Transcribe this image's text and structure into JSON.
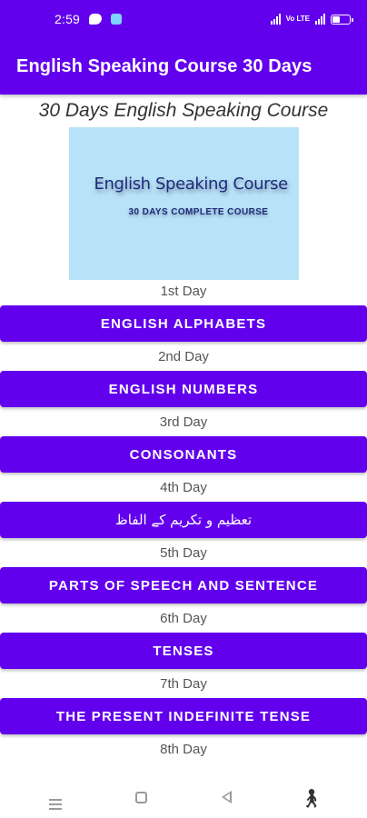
{
  "status": {
    "time": "2:59",
    "network_badge": "Vo LTE"
  },
  "appbar": {
    "title": "English Speaking Course 30 Days"
  },
  "header": {
    "subtitle": "30 Days English Speaking Course"
  },
  "banner": {
    "title": "English Speaking Course",
    "subtitle": "30 DAYS COMPLETE COURSE"
  },
  "lessons": [
    {
      "day": "1st Day",
      "label": "ENGLISH ALPHABETS"
    },
    {
      "day": "2nd Day",
      "label": "ENGLISH NUMBERS"
    },
    {
      "day": "3rd Day",
      "label": "CONSONANTS"
    },
    {
      "day": "4th Day",
      "label": "تعظیم و تکریم کے الفاظ"
    },
    {
      "day": "5th Day",
      "label": "PARTS OF SPEECH AND SENTENCE"
    },
    {
      "day": "6th Day",
      "label": "TENSES"
    },
    {
      "day": "7th Day",
      "label": "THE PRESENT INDEFINITE TENSE"
    },
    {
      "day": "8th Day",
      "label": ""
    }
  ],
  "colors": {
    "primary": "#6200ee",
    "banner_bg": "#b8e2f7"
  },
  "icons": {
    "nav": [
      "menu-icon",
      "home-square-icon",
      "back-triangle-icon",
      "accessibility-icon"
    ]
  }
}
